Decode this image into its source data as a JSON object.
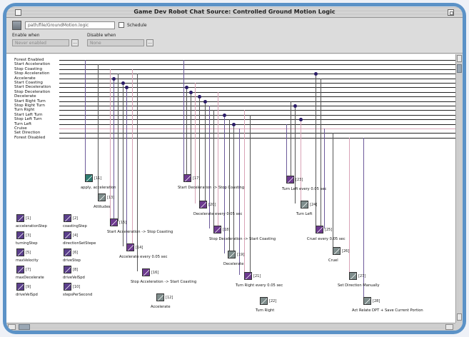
{
  "window": {
    "title": "Game Dev Robot Chat Source: Controlled Ground Motion Logic"
  },
  "toolbar": {
    "path_value": "path/file/GroundMotion.logic",
    "checkbox_label": "Schedule",
    "enable_label": "Enable when",
    "disable_label": "Disable when",
    "enable_value": "Never enabled",
    "disable_value": "None",
    "browse_glyph": "..."
  },
  "colors": {
    "chrome": "#5b92c7",
    "purple_icon": "#6d3a8f",
    "green_icon": "#2f7c72",
    "gray_icon": "#7e8d8c",
    "line_dark": "#222222",
    "line_pink": "#d9a3b6"
  },
  "signals": [
    {
      "label": "Forest Enabled"
    },
    {
      "label": "Start Acceleration"
    },
    {
      "label": "Stop Coasting"
    },
    {
      "label": "Stop Acceleration"
    },
    {
      "label": "Accelerate"
    },
    {
      "label": "Start Coasting"
    },
    {
      "label": "Start Deceleration"
    },
    {
      "label": "Stop Deceleration"
    },
    {
      "label": "Decelerate"
    },
    {
      "label": "Start Right Turn"
    },
    {
      "label": "Stop Right Turn"
    },
    {
      "label": "Turn Right"
    },
    {
      "label": "Start Left Turn"
    },
    {
      "label": "Stop Left Turn"
    },
    {
      "label": "Turn Left"
    },
    {
      "label": "Cruise"
    },
    {
      "label": "Set Direction"
    },
    {
      "label": "Forest Disabled"
    }
  ],
  "nodes": [
    {
      "num": "[11]",
      "icon": "green-icon",
      "color": "#2f7c72",
      "label": "apply, acceleration"
    },
    {
      "num": "[13]",
      "icon": "gray-icon",
      "color": "#7e8d8c",
      "label": "Attitudes"
    },
    {
      "num": "[15]",
      "icon": "purple-icon",
      "color": "#6d3a8f",
      "label": "Start Acceleration -> Stop Coasting"
    },
    {
      "num": "[14]",
      "icon": "purple-icon",
      "color": "#6d3a8f",
      "label": "Accelerate every 0.05 sec"
    },
    {
      "num": "[16]",
      "icon": "purple-icon",
      "color": "#6d3a8f",
      "label": "Stop Acceleration -> Start Coasting"
    },
    {
      "num": "[12]",
      "icon": "gray-icon",
      "color": "#7e8d8c",
      "label": "Accelerate"
    },
    {
      "num": "[17]",
      "icon": "purple-icon",
      "color": "#6d3a8f",
      "label": "Start Deceleration -> Stop Coasting"
    },
    {
      "num": "[20]",
      "icon": "purple-icon",
      "color": "#6d3a8f",
      "label": "Decelerate every 0.05 sec"
    },
    {
      "num": "[18]",
      "icon": "purple-icon",
      "color": "#6d3a8f",
      "label": "Stop Deceleration -> Start Coasting"
    },
    {
      "num": "[19]",
      "icon": "gray-icon",
      "color": "#7e8d8c",
      "label": "Decelerate"
    },
    {
      "num": "[21]",
      "icon": "purple-icon",
      "color": "#6d3a8f",
      "label": "Turn Right every 0.05 sec"
    },
    {
      "num": "[22]",
      "icon": "gray-icon",
      "color": "#7e8d8c",
      "label": "Turn Right"
    },
    {
      "num": "[23]",
      "icon": "purple-icon",
      "color": "#6d3a8f",
      "label": "Turn Left every 0.05 sec"
    },
    {
      "num": "[24]",
      "icon": "gray-icon",
      "color": "#7e8d8c",
      "label": "Turn Left"
    },
    {
      "num": "[25]",
      "icon": "purple-icon",
      "color": "#6d3a8f",
      "label": "Cruel every 0.05 sec"
    },
    {
      "num": "[26]",
      "icon": "gray-icon",
      "color": "#7e8d8c",
      "label": "Cruel"
    },
    {
      "num": "[27]",
      "icon": "gray-icon",
      "color": "#7e8d8c",
      "label": "Set Direction Manually"
    },
    {
      "num": "[28]",
      "icon": "gray-icon",
      "color": "#7e8d8c",
      "label": "Act Relate DPT + Save Current Portion"
    }
  ],
  "palette": [
    {
      "num": "[1]",
      "icon": "purple-icon",
      "color": "#5b3f8c",
      "label": "accelerationStep"
    },
    {
      "num": "[2]",
      "icon": "purple-icon",
      "color": "#5b3f8c",
      "label": "coastingStep"
    },
    {
      "num": "[3]",
      "icon": "purple-icon",
      "color": "#5b3f8c",
      "label": "turningStep"
    },
    {
      "num": "[4]",
      "icon": "purple-icon",
      "color": "#5b3f8c",
      "label": "directionSetStepe"
    },
    {
      "num": "[5]",
      "icon": "purple-icon",
      "color": "#5b3f8c",
      "label": "maxVelocity"
    },
    {
      "num": "[6]",
      "icon": "purple-icon",
      "color": "#5b3f8c",
      "label": "driveStep"
    },
    {
      "num": "[7]",
      "icon": "purple-icon",
      "color": "#5b3f8c",
      "label": "maxDecelerate"
    },
    {
      "num": "[8]",
      "icon": "purple-icon",
      "color": "#5b3f8c",
      "label": "driveVelSpd"
    },
    {
      "num": "[9]",
      "icon": "purple-icon",
      "color": "#5b3f8c",
      "label": "driveVelSpd"
    },
    {
      "num": "[10]",
      "icon": "purple-icon",
      "color": "#5b3f8c",
      "label": "stepsPerSecond"
    }
  ]
}
